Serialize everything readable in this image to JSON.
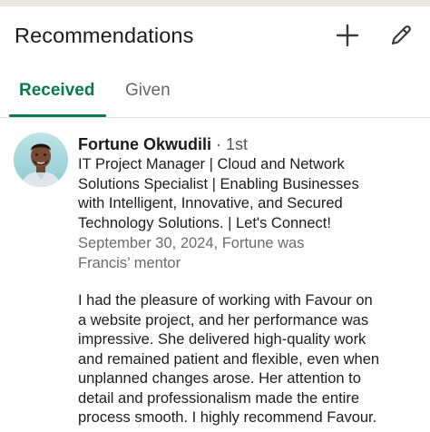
{
  "header": {
    "title": "Recommendations",
    "add_icon": "plus-icon",
    "edit_icon": "pencil-icon"
  },
  "tabs": [
    {
      "label": "Received",
      "active": true
    },
    {
      "label": "Given",
      "active": false
    }
  ],
  "colors": {
    "accent": "#0a7a4a",
    "inactive_tab": "#666666",
    "meta_text": "#6b6b6b"
  },
  "recommendation": {
    "name": "Fortune Okwudili",
    "degree": " · 1st",
    "headline_lines": [
      "IT Project Manager | Cloud and Network",
      "Solutions Specialist | Enabling Businesses",
      "with Intelligent, Innovative, and Secured",
      "Technology Solutions. | Let's Connect!"
    ],
    "meta_lines": [
      "September 30, 2024, Fortune was",
      "Francis’ mentor"
    ],
    "body_lines": [
      "I had the pleasure of working with Favour on",
      "a website project, and her performance was",
      "impressive. She delivered high-quality work",
      "and remained patient and flexible, even when",
      "unplanned changes arose. Her attention to",
      "detail and professionalism made the entire",
      "process smooth. I highly recommend Favour."
    ]
  }
}
